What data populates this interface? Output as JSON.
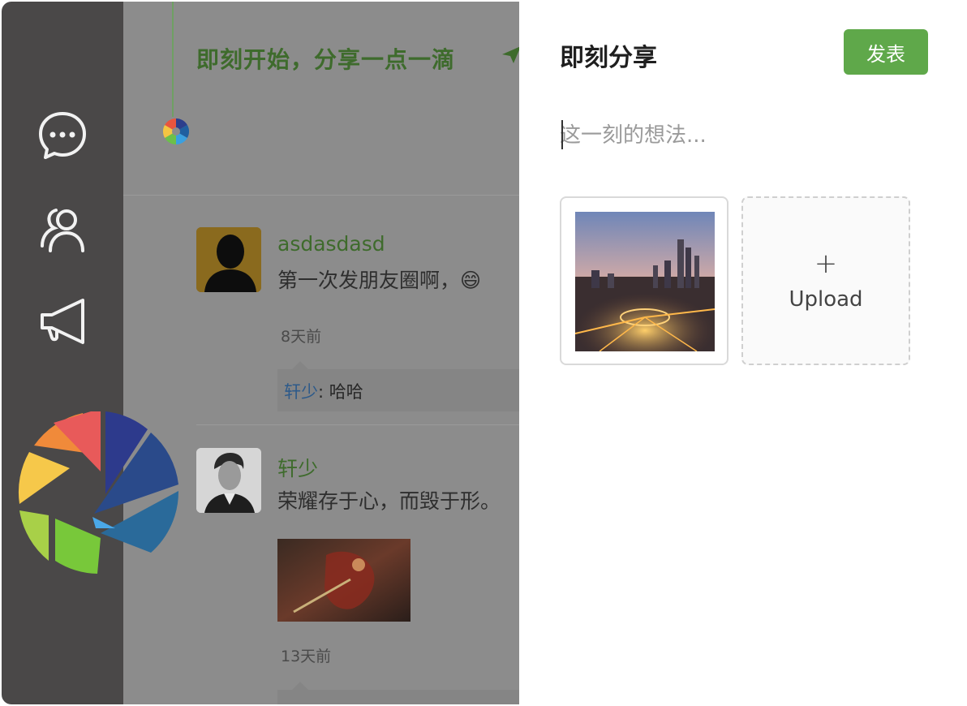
{
  "sidebar": {
    "items": [
      {
        "icon": "chat-bubble-icon"
      },
      {
        "icon": "users-icon"
      },
      {
        "icon": "megaphone-icon"
      }
    ]
  },
  "feed": {
    "slogan": "即刻开始，分享一点一滴",
    "posts": [
      {
        "author": "asdasdasd",
        "text": "第一次发朋友圈啊，😄",
        "time": "8天前",
        "comment": {
          "author": "轩少",
          "separator": ": ",
          "text": "哈哈"
        }
      },
      {
        "author": "轩少",
        "text": "荣耀存于心，而毁于形。",
        "time": "13天前"
      }
    ]
  },
  "share_panel": {
    "title": "即刻分享",
    "publish_label": "发表",
    "thought_placeholder": "这一刻的想法...",
    "upload_plus": "+",
    "upload_label": "Upload"
  },
  "colors": {
    "rail": "#4a4848",
    "accent_green": "#5fa84a",
    "feed_name_green": "#3e6b2c",
    "comment_author_blue": "#2d5a8a"
  }
}
